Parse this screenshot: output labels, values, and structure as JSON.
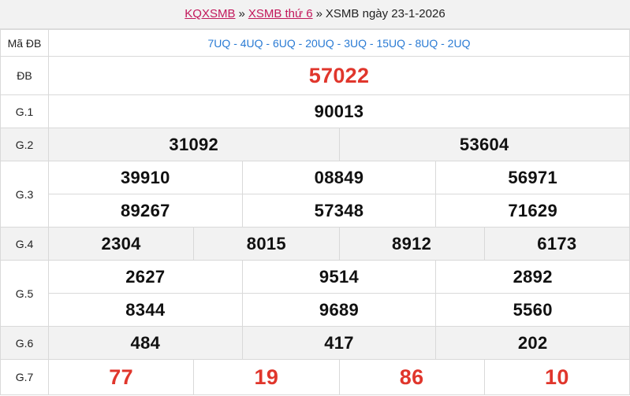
{
  "breadcrumb": {
    "link1": "KQXSMB",
    "link2": "XSMB thứ 6",
    "current": "XSMB ngày 23-1-2026",
    "separator": "»"
  },
  "labels": {
    "ma_db": "Mã ĐB",
    "db": "ĐB",
    "g1": "G.1",
    "g2": "G.2",
    "g3": "G.3",
    "g4": "G.4",
    "g5": "G.5",
    "g6": "G.6",
    "g7": "G.7"
  },
  "ma_db_codes": "7UQ - 4UQ - 6UQ - 20UQ - 3UQ - 15UQ - 8UQ - 2UQ",
  "prizes": {
    "db": [
      "57022"
    ],
    "g1": [
      "90013"
    ],
    "g2": [
      "31092",
      "53604"
    ],
    "g3": [
      "39910",
      "08849",
      "56971",
      "89267",
      "57348",
      "71629"
    ],
    "g4": [
      "2304",
      "8015",
      "8912",
      "6173"
    ],
    "g5": [
      "2627",
      "9514",
      "2892",
      "8344",
      "9689",
      "5560"
    ],
    "g6": [
      "484",
      "417",
      "202"
    ],
    "g7": [
      "77",
      "19",
      "86",
      "10"
    ]
  }
}
